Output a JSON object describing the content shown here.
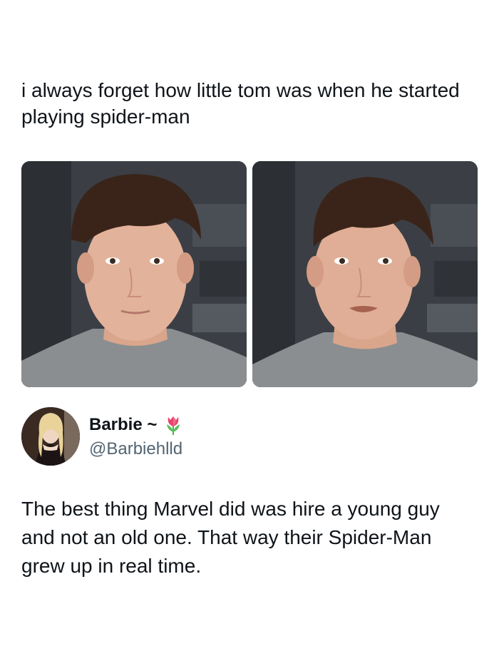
{
  "post": {
    "text": "i always forget how little tom was when he started playing spider-man"
  },
  "photos": [
    {
      "name": "photo-left"
    },
    {
      "name": "photo-right"
    }
  ],
  "quoted": {
    "display_name": "Barbie ~",
    "emoji": "tulip-icon",
    "handle": "@Barbiehlld",
    "text": "The best thing Marvel did was hire a young guy and not an old one. That way their Spider-Man grew up in real time."
  },
  "colors": {
    "text": "#0f1419",
    "handle": "#536471",
    "background": "#ffffff",
    "tulip": "#e8436b"
  }
}
